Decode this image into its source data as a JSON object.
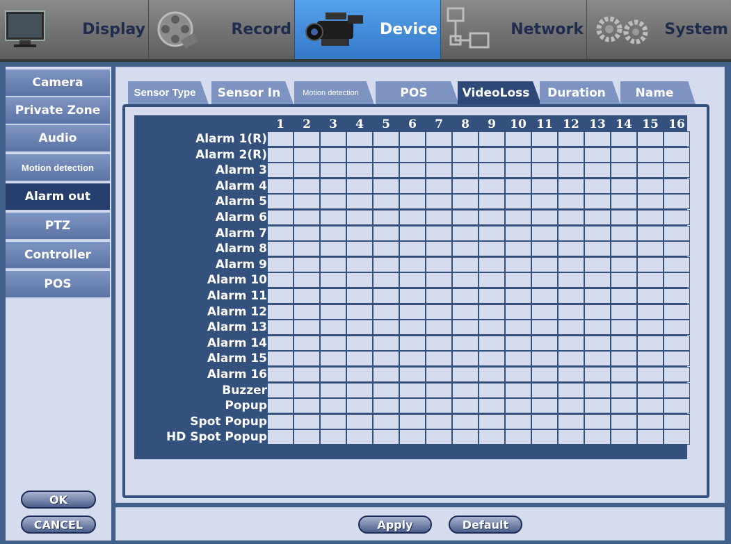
{
  "topmenu": {
    "display": "Display",
    "record": "Record",
    "device": "Device",
    "network": "Network",
    "system": "System"
  },
  "sidebar": {
    "items": [
      "Camera",
      "Private Zone",
      "Audio",
      "Motion detection",
      "Alarm out",
      "PTZ",
      "Controller",
      "POS"
    ],
    "active": "Alarm out"
  },
  "tabs": {
    "items": [
      "Sensor Type",
      "Sensor In",
      "Motion detection",
      "POS",
      "VideoLoss",
      "Duration",
      "Name"
    ],
    "active": "VideoLoss"
  },
  "grid": {
    "columns": [
      "1",
      "2",
      "3",
      "4",
      "5",
      "6",
      "7",
      "8",
      "9",
      "10",
      "11",
      "12",
      "13",
      "14",
      "15",
      "16"
    ],
    "rows": [
      "Alarm 1(R)",
      "Alarm 2(R)",
      "Alarm 3",
      "Alarm 4",
      "Alarm 5",
      "Alarm 6",
      "Alarm 7",
      "Alarm 8",
      "Alarm 9",
      "Alarm 10",
      "Alarm 11",
      "Alarm 12",
      "Alarm 13",
      "Alarm 14",
      "Alarm 15",
      "Alarm 16",
      "Buzzer",
      "Popup",
      "Spot Popup",
      "HD Spot Popup"
    ]
  },
  "buttons": {
    "ok": "OK",
    "cancel": "CANCEL",
    "apply": "Apply",
    "default": "Default"
  },
  "colors": {
    "background": "#41618a",
    "panel": "#d4dcee",
    "header": "#34507c",
    "active_top": "#3f8ae0",
    "tab": "#7d93c2"
  }
}
